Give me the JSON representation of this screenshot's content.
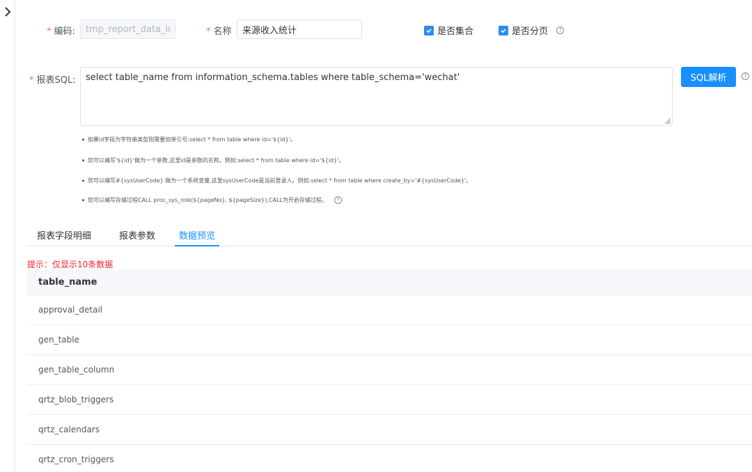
{
  "form": {
    "code": {
      "label": "编码:",
      "value": "tmp_report_data_inco"
    },
    "name": {
      "label": "名称",
      "value": "来源收入统计"
    },
    "is_collection": {
      "label": "是否集合",
      "checked": true
    },
    "is_paged": {
      "label": "是否分页",
      "checked": true
    },
    "sql": {
      "label": "报表SQL:",
      "value": "select table_name from information_schema.tables where table_schema='wechat'",
      "parse_button": "SQL解析"
    }
  },
  "tips": [
    "如果id字段为字符串类型则需要加单引号:select * from table where id='${id}'。",
    "您可以编写'${id}'做为一个参数,这里id是参数的名称。例如:select * from table where id='${id}'。",
    "您可以编写#{sysUserCode} 做为一个系统变量,这里sysUserCode是当前登录人。例如:select * from table where create_by='#{sysUserCode}'。",
    "您可以编写存储过程CALL proc_sys_role(${pageNo}, ${pageSize}),CALL为开启存储过程。"
  ],
  "tabs": [
    {
      "label": "报表字段明细",
      "active": false
    },
    {
      "label": "报表参数",
      "active": false
    },
    {
      "label": "数据预览",
      "active": true
    }
  ],
  "preview": {
    "notice": "提示：仅显示10条数据",
    "column": "table_name",
    "rows": [
      "approval_detail",
      "gen_table",
      "gen_table_column",
      "qrtz_blob_triggers",
      "qrtz_calendars",
      "qrtz_cron_triggers"
    ]
  },
  "colors": {
    "primary": "#1890ff",
    "required": "#f56c6c",
    "notice": "#f5222d"
  }
}
